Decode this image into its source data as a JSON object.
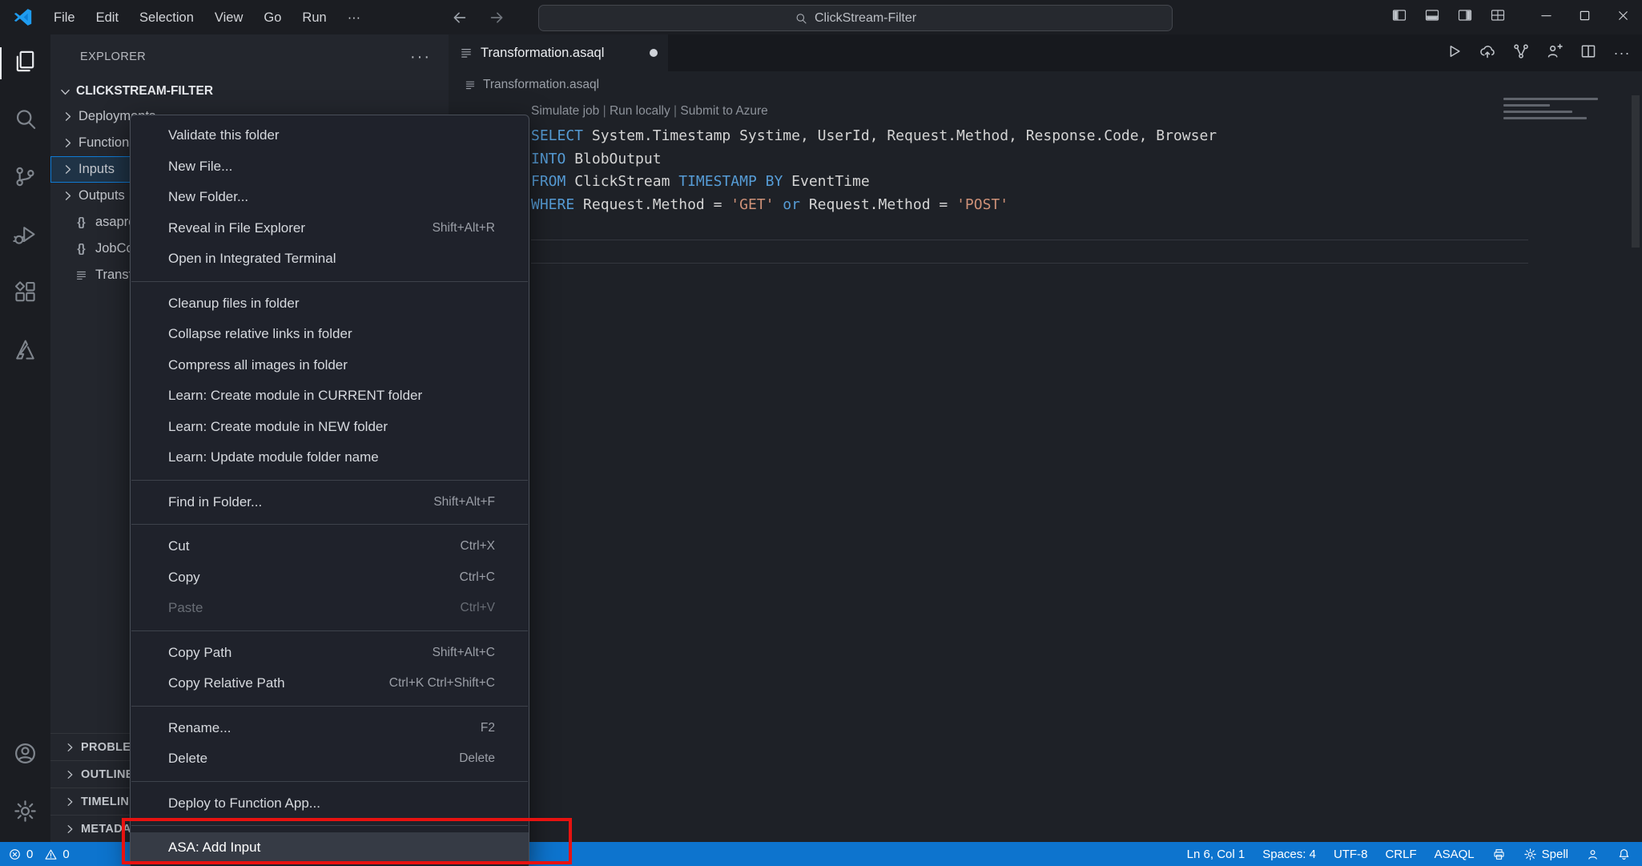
{
  "titlebar": {
    "menus": [
      "File",
      "Edit",
      "Selection",
      "View",
      "Go",
      "Run",
      "···"
    ],
    "search": "ClickStream-Filter",
    "layout_icons": [
      "layout-sidebar",
      "layout-panel",
      "layout-sidebar-right",
      "layout-grid"
    ],
    "window_buttons": [
      "minimize",
      "maximize",
      "close"
    ]
  },
  "activitybar": {
    "top": [
      {
        "icon": "files",
        "active": true
      },
      {
        "icon": "search"
      },
      {
        "icon": "source-control"
      },
      {
        "icon": "run-debug"
      },
      {
        "icon": "extensions"
      },
      {
        "icon": "azure"
      }
    ],
    "bottom": [
      {
        "icon": "account"
      },
      {
        "icon": "settings"
      }
    ]
  },
  "sidebar": {
    "title": "EXPLORER",
    "root": "CLICKSTREAM-FILTER",
    "tree": [
      {
        "label": "Deployments",
        "type": "folder"
      },
      {
        "label": "Functions",
        "type": "folder"
      },
      {
        "label": "Inputs",
        "type": "folder",
        "selected": true
      },
      {
        "label": "Outputs",
        "type": "folder"
      },
      {
        "label": "asaproj.json",
        "type": "json"
      },
      {
        "label": "JobConfig.json",
        "type": "json"
      },
      {
        "label": "Transformation.asaql",
        "type": "file"
      }
    ],
    "panels": [
      "PROBLEMS",
      "OUTLINE",
      "TIMELINE",
      "METADATA"
    ]
  },
  "context_menu": {
    "items": [
      {
        "label": "Validate this folder"
      },
      {
        "label": "New File..."
      },
      {
        "label": "New Folder..."
      },
      {
        "label": "Reveal in File Explorer",
        "shortcut": "Shift+Alt+R"
      },
      {
        "label": "Open in Integrated Terminal"
      },
      {
        "separator": true
      },
      {
        "label": "Cleanup files in folder"
      },
      {
        "label": "Collapse relative links in folder"
      },
      {
        "label": "Compress all images in folder"
      },
      {
        "label": "Learn: Create module in CURRENT folder"
      },
      {
        "label": "Learn: Create module in NEW folder"
      },
      {
        "label": "Learn: Update module folder name"
      },
      {
        "separator": true
      },
      {
        "label": "Find in Folder...",
        "shortcut": "Shift+Alt+F"
      },
      {
        "separator": true
      },
      {
        "label": "Cut",
        "shortcut": "Ctrl+X"
      },
      {
        "label": "Copy",
        "shortcut": "Ctrl+C"
      },
      {
        "label": "Paste",
        "shortcut": "Ctrl+V",
        "disabled": true
      },
      {
        "separator": true
      },
      {
        "label": "Copy Path",
        "shortcut": "Shift+Alt+C"
      },
      {
        "label": "Copy Relative Path",
        "shortcut": "Ctrl+K Ctrl+Shift+C"
      },
      {
        "separator": true
      },
      {
        "label": "Rename...",
        "shortcut": "F2"
      },
      {
        "label": "Delete",
        "shortcut": "Delete"
      },
      {
        "separator": true
      },
      {
        "label": "Deploy to Function App..."
      },
      {
        "separator": true
      },
      {
        "label": "ASA: Add Input",
        "highlighted": true
      }
    ]
  },
  "editor": {
    "tab": {
      "label": "Transformation.asaql",
      "modified": true
    },
    "breadcrumb": "Transformation.asaql",
    "actions": [
      "run",
      "cloud-upload",
      "hierarchy",
      "feedback",
      "split-editor",
      "more"
    ],
    "codelens": [
      "Simulate job",
      "Run locally",
      "Submit to Azure"
    ],
    "code_lines": [
      {
        "tokens": [
          {
            "t": "SELECT",
            "c": "kw"
          },
          {
            "t": " System.Timestamp Systime, UserId, Request.Method, Response.Code, Browser",
            "c": "pl"
          }
        ]
      },
      {
        "tokens": [
          {
            "t": "INTO",
            "c": "kw"
          },
          {
            "t": " BlobOutput",
            "c": "pl"
          }
        ]
      },
      {
        "tokens": [
          {
            "t": "FROM",
            "c": "kw"
          },
          {
            "t": " ClickStream ",
            "c": "pl"
          },
          {
            "t": "TIMESTAMP",
            "c": "kw"
          },
          {
            "t": " ",
            "c": "pl"
          },
          {
            "t": "BY",
            "c": "kw"
          },
          {
            "t": " EventTime",
            "c": "pl"
          }
        ]
      },
      {
        "tokens": [
          {
            "t": "WHERE",
            "c": "kw"
          },
          {
            "t": " Request.Method = ",
            "c": "pl"
          },
          {
            "t": "'GET'",
            "c": "str"
          },
          {
            "t": " ",
            "c": "pl"
          },
          {
            "t": "or",
            "c": "kw"
          },
          {
            "t": " Request.Method = ",
            "c": "pl"
          },
          {
            "t": "'POST'",
            "c": "str"
          }
        ]
      },
      {
        "tokens": []
      },
      {
        "tokens": [],
        "current": true
      }
    ]
  },
  "statusbar": {
    "errors": "0",
    "warnings": "0",
    "right": [
      {
        "label": "Ln 6, Col 1"
      },
      {
        "label": "Spaces: 4"
      },
      {
        "label": "UTF-8"
      },
      {
        "label": "CRLF"
      },
      {
        "label": "ASAQL"
      },
      {
        "icon": "printer"
      },
      {
        "icon": "gear",
        "label": "Spell"
      },
      {
        "icon": "person"
      },
      {
        "icon": "bell"
      }
    ]
  },
  "colors": {
    "statusbar_blue": "#0d74ce",
    "keyword_blue": "#569cd6",
    "string_orange": "#ce9178",
    "annotation_red": "#e81210",
    "selection_blue": "#0f7ad4"
  }
}
